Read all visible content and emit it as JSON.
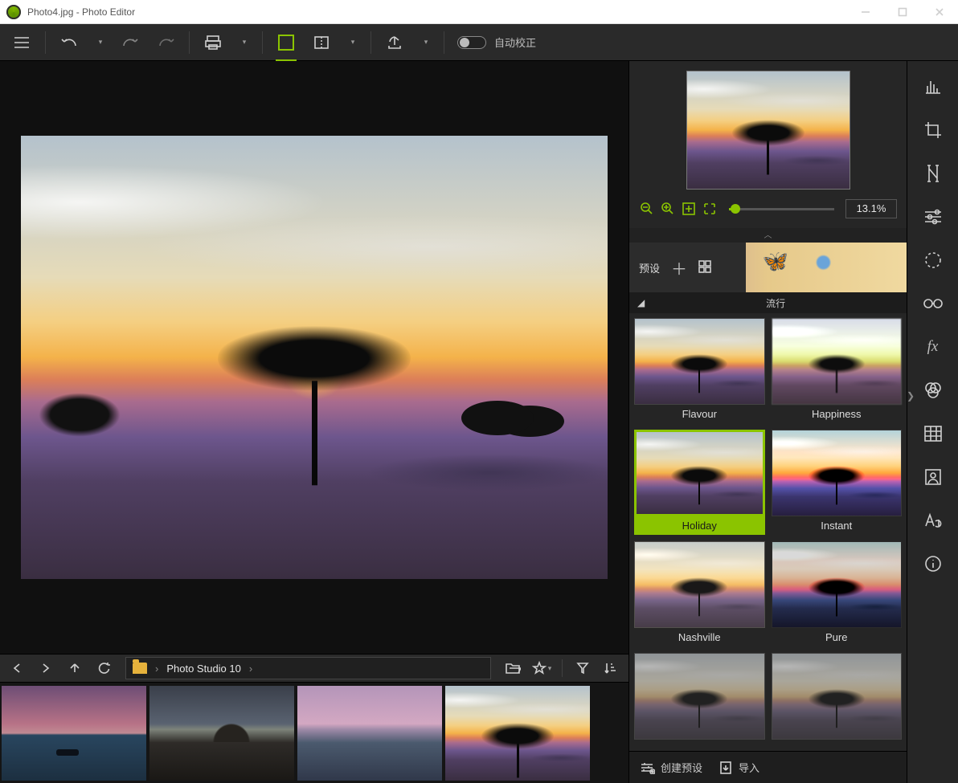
{
  "window": {
    "title": "Photo4.jpg - Photo Editor"
  },
  "toolbar": {
    "auto_correct": "自动校正"
  },
  "browser": {
    "path_label": "Photo Studio 10"
  },
  "sidepanel": {
    "zoom_value": "13.1%",
    "presets_label": "预设",
    "category_label": "流行",
    "presets": [
      {
        "name": "Flavour",
        "selected": false,
        "variant": ""
      },
      {
        "name": "Happiness",
        "selected": false,
        "variant": "variant-happiness"
      },
      {
        "name": "Holiday",
        "selected": true,
        "variant": ""
      },
      {
        "name": "Instant",
        "selected": false,
        "variant": "variant-instant"
      },
      {
        "name": "Nashville",
        "selected": false,
        "variant": "variant-nashville"
      },
      {
        "name": "Pure",
        "selected": false,
        "variant": "variant-pure"
      },
      {
        "name": "",
        "selected": false,
        "variant": "variant-muted"
      },
      {
        "name": "",
        "selected": false,
        "variant": "variant-muted"
      }
    ],
    "create_preset": "创建预设",
    "import": "导入"
  },
  "colors": {
    "accent": "#8bc400"
  }
}
